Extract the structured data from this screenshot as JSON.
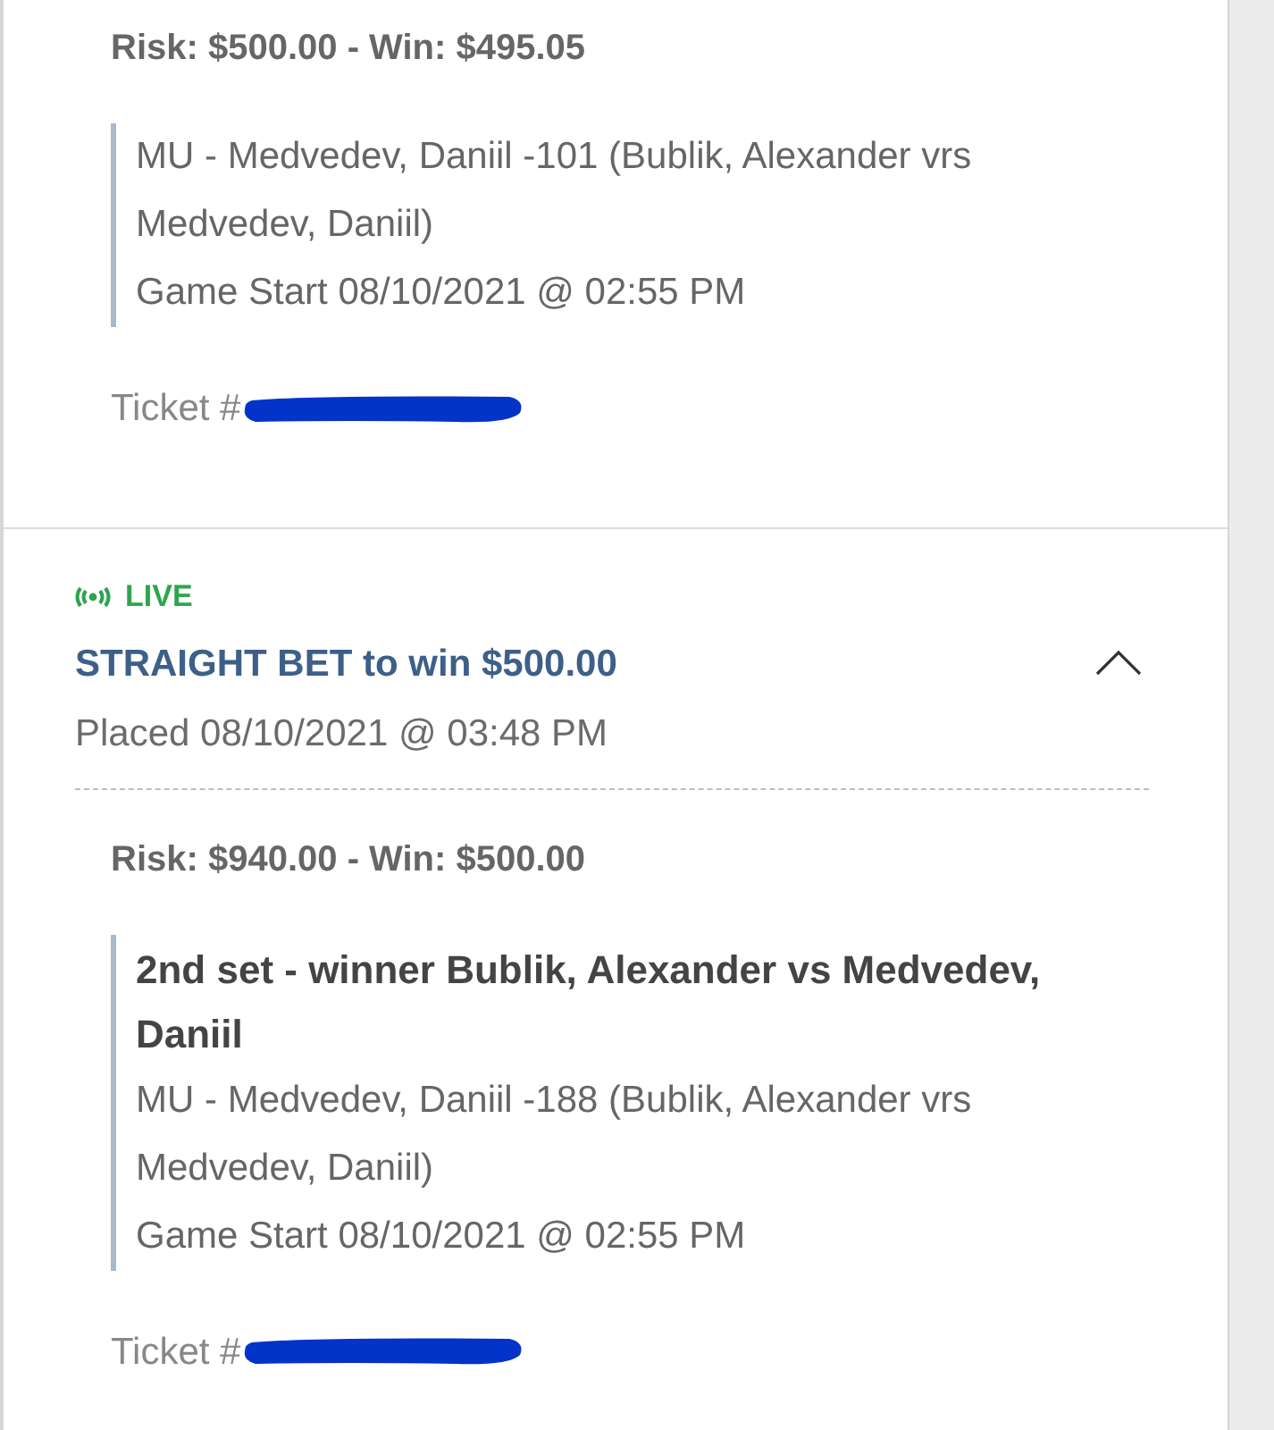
{
  "bets": [
    {
      "risk_win": "Risk: $500.00 - Win: $495.05",
      "selection": {
        "lines": [
          "MU - Medvedev, Daniil -101 (Bublik, Alexander vrs Medvedev, Daniil)",
          "Game Start 08/10/2021 @ 02:55 PM"
        ]
      },
      "ticket_label": "Ticket #",
      "ticket_redacted": true
    },
    {
      "header": {
        "live": "LIVE",
        "title": "STRAIGHT BET to win $500.00",
        "placed": "Placed 08/10/2021 @ 03:48 PM",
        "expanded": true
      },
      "risk_win": "Risk: $940.00 - Win: $500.00",
      "selection": {
        "title": "2nd set - winner Bublik, Alexander vs Medvedev, Daniil",
        "lines": [
          "MU - Medvedev, Daniil -188 (Bublik, Alexander vrs Medvedev, Daniil)",
          "Game Start 08/10/2021 @ 02:55 PM"
        ]
      },
      "ticket_label": "Ticket #",
      "ticket_redacted": true
    }
  ]
}
